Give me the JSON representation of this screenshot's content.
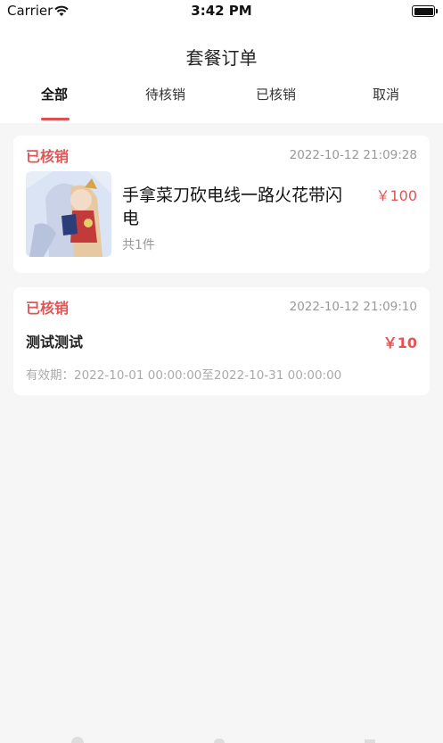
{
  "status_bar": {
    "carrier": "Carrier",
    "time": "3:42 PM"
  },
  "nav": {
    "title": "套餐订单"
  },
  "tabs": [
    {
      "label": "全部",
      "active": true
    },
    {
      "label": "待核销",
      "active": false
    },
    {
      "label": "已核销",
      "active": false
    },
    {
      "label": "取消",
      "active": false
    }
  ],
  "orders": [
    {
      "status": "已核销",
      "time": "2022-10-12 21:09:28",
      "product_name": "手拿菜刀砍电线一路火花带闪电",
      "price": "￥100",
      "quantity": "共1件"
    },
    {
      "status": "已核销",
      "time": "2022-10-12 21:09:10",
      "package_name": "测试测试",
      "price": "￥10",
      "validity": "有效期：2022-10-01 00:00:00至2022-10-31 00:00:00"
    }
  ],
  "colors": {
    "accent": "#e05555",
    "background": "#f6f6f6",
    "muted": "#999999"
  },
  "icons": [
    "wifi-icon",
    "battery-icon",
    "product-thumbnail"
  ]
}
